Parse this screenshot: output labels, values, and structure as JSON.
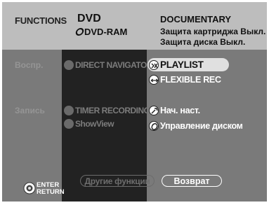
{
  "header": {
    "section": "FUNCTIONS",
    "disc_type": "DVD",
    "media": "DVD-RAM",
    "genre": "DOCUMENTARY",
    "cartridge_protection": "Защита картриджа  Выкл.",
    "disc_protection": "Защита диска   Выкл."
  },
  "left": {
    "play_label": "Воспр.",
    "record_label": "Запись"
  },
  "middle": {
    "direct_navigator": "DIRECT NAVIGATOR",
    "timer_recording": "TIMER RECORDING",
    "showview": "ShowView"
  },
  "right": {
    "playlist": "PLAYLIST",
    "flexible_rec": "FLEXIBLE REC",
    "initial_setup": "Нач. наст.",
    "disc_management": "Управление диском"
  },
  "buttons": {
    "other_functions": "Другие функции",
    "return": "Возврат"
  },
  "hint": {
    "enter": "ENTER",
    "return": "RETURN"
  },
  "colors": {
    "background": "#bdbdbd",
    "panel_gray": "#7a7a7a",
    "panel_dark": "#222222",
    "highlight": "#e0e0e0"
  }
}
